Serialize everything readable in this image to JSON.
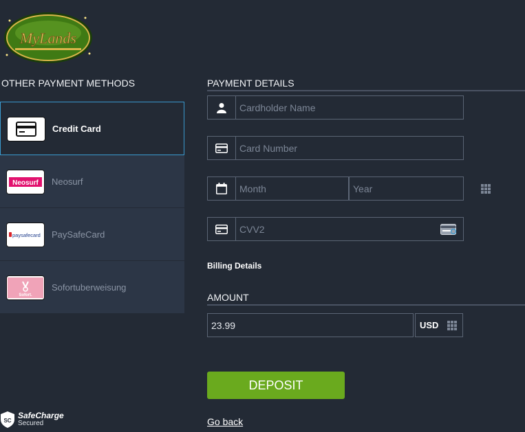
{
  "logo": {
    "text": "MyLands"
  },
  "left_panel": {
    "title": "OTHER PAYMENT METHODS",
    "methods": [
      {
        "label": "Credit Card",
        "selected": true,
        "icon": "credit-card-icon"
      },
      {
        "label": "Neosurf",
        "selected": false,
        "logo_text": "Neosurf"
      },
      {
        "label": "PaySafeCard",
        "selected": false,
        "logo_text": "paysafecard"
      },
      {
        "label": "Sofortuberweisung",
        "selected": false,
        "logo_text": "Sofort."
      }
    ]
  },
  "payment_details": {
    "title": "PAYMENT DETAILS",
    "cardholder_placeholder": "Cardholder Name",
    "card_number_placeholder": "Card Number",
    "month_placeholder": "Month",
    "year_placeholder": "Year",
    "cvv_placeholder": "CVV2"
  },
  "billing": {
    "label": "Billing Details"
  },
  "amount": {
    "title": "AMOUNT",
    "value": "23.99",
    "currency": "USD"
  },
  "actions": {
    "deposit_label": "DEPOSIT",
    "go_back_label": "Go back"
  },
  "footer": {
    "brand": "SafeCharge",
    "sub": "Secured",
    "badge": "SC"
  },
  "colors": {
    "background": "#232a35",
    "panel": "#2c3646",
    "accent_border": "#3a9bd1",
    "deposit": "#6aaa1e",
    "logo_green": "#3f7a14",
    "logo_gold": "#d9b64a"
  }
}
